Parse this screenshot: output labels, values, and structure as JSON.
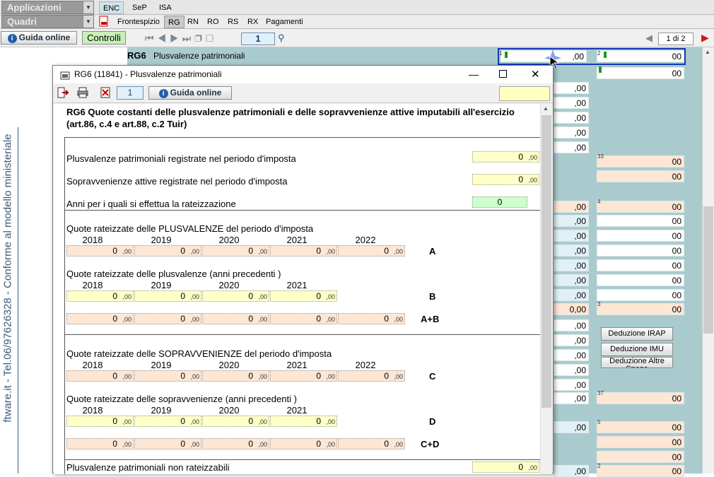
{
  "nav": {
    "applicazioni": "Applicazioni",
    "quadri": "Quadri",
    "tabs1": [
      "ENC",
      "SeP",
      "ISA"
    ],
    "tabs2": [
      "Frontespizio",
      "RG",
      "RN",
      "RO",
      "RS",
      "RX",
      "Pagamenti"
    ],
    "guida": "Guida online",
    "controlli": "Controlli",
    "page": "1",
    "page_of": "1 di 2"
  },
  "side": {
    "vertical": "ftware.it - Tel.06/97626328 - Conforme al modello ministeriale"
  },
  "bg": {
    "rg6_code": "RG6",
    "rg6_title": "Plusvalenze patrimoniali",
    "zero": ",00",
    "zero_b": "00",
    "zero0": "0",
    "zero_00": "0,00",
    "col1": "1",
    "col2": "2",
    "col3": "3",
    "col4": "4",
    "col5": "5",
    "col33": "33",
    "col37": "37",
    "ded_irap": "Deduzione IRAP",
    "ded_imu": "Deduzione IMU",
    "ded_altre": "Deduzione Altre Spese"
  },
  "dialog": {
    "title": "RG6 (11841) - Plusvalenze patrimoniali",
    "page": "1",
    "guida": "Guida online",
    "heading": "RG6 Quote costanti delle plusvalenze patrimoniali e delle sopravvenienze attive imputabili all'esercizio (art.86, c.4 e art.88, c.2 Tuir)",
    "plus_reg": "Plusvalenze patrimoniali registrate nel periodo d'imposta",
    "sopr_reg": "Sopravvenienze attive registrate nel periodo d'imposta",
    "anni": "Anni per i quali si effettua la rateizzazione",
    "anni_val": "0",
    "quote_plus": "Quote rateizzate delle PLUSVALENZE del periodo d'imposta",
    "quote_plus_prec": "Quote rateizzate delle plusvalenze  (anni precedenti )",
    "quote_sopr": "Quote rateizzate delle SOPRAVVENIENZE del periodo d'imposta",
    "quote_sopr_prec": "Quote rateizzate delle sopravvenienze  (anni precedenti )",
    "non_rate": "Plusvalenze patrimoniali non rateizzabili",
    "years5": [
      "2018",
      "2019",
      "2020",
      "2021",
      "2022"
    ],
    "years4": [
      "2018",
      "2019",
      "2020",
      "2021"
    ],
    "zero": "0",
    "dec": ",00",
    "lA": "A",
    "lB": "B",
    "lAB": "A+B",
    "lC": "C",
    "lD": "D",
    "lCD": "C+D"
  }
}
